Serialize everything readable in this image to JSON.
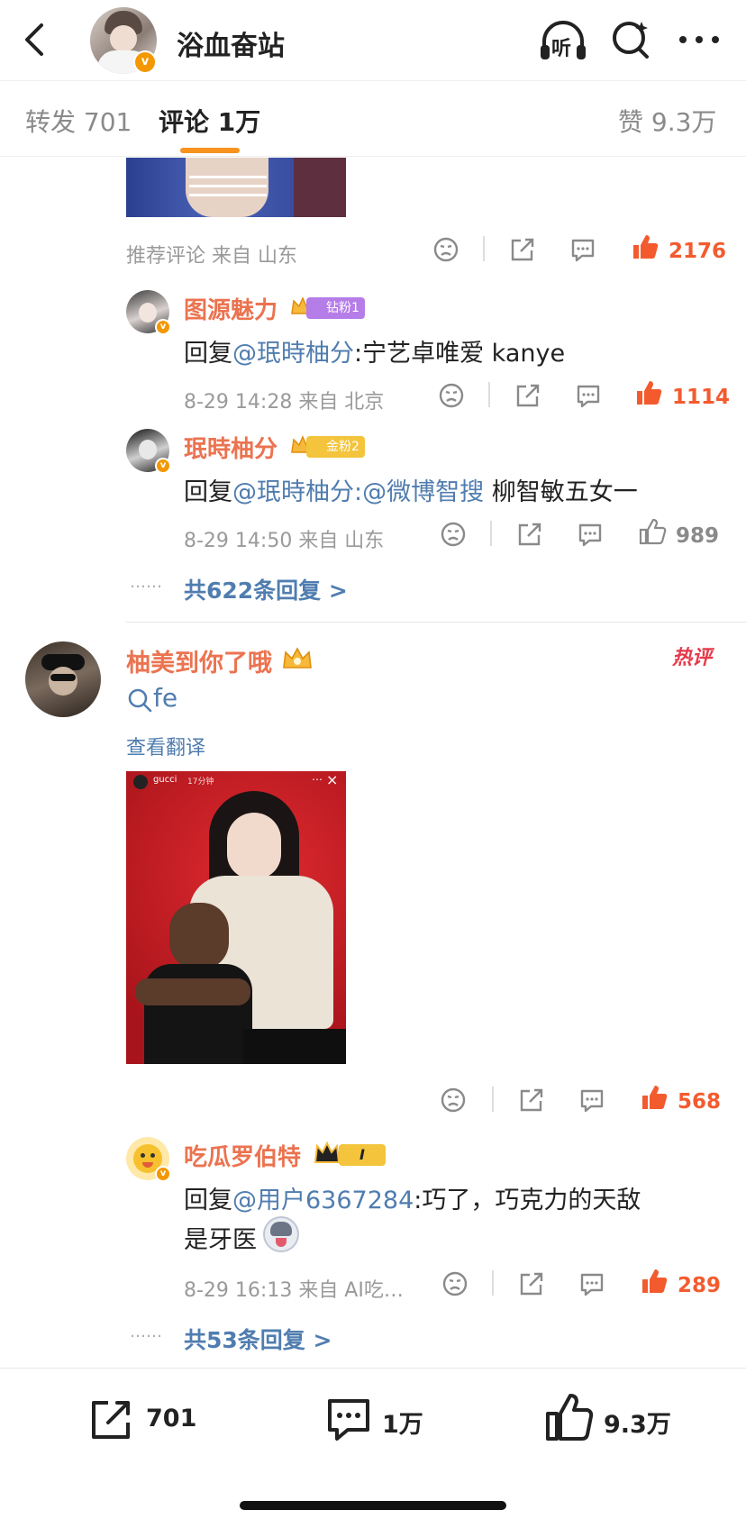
{
  "header": {
    "title": "浴血奋站",
    "verified_icon": "v-badge",
    "icons": [
      "back-chevron-icon",
      "listen-headphones-icon",
      "search-icon",
      "more-icon"
    ],
    "listen_label": "听"
  },
  "tabs": {
    "repost": "转发 701",
    "comments": "评论 1万",
    "likes": "赞 9.3万",
    "active": "comments",
    "accent": "#f7931e"
  },
  "comment1": {
    "meta": "推荐评论  来自 山东",
    "likes": "2176",
    "replies": [
      {
        "name": "图源魅力",
        "badge": "钻粉1",
        "reply_prefix": "回复",
        "mention": "@珉時柚分",
        "text": ":宁艺卓唯爱 kanye",
        "meta": "8-29 14:28  来自 北京",
        "likes": "1114"
      },
      {
        "name": "珉時柚分",
        "badge": "金粉2",
        "reply_prefix": "回复",
        "mention": "@珉時柚分",
        "mention2": ":@微博智搜",
        "text": " 柳智敏五女一",
        "meta": "8-29 14:50  来自 山东",
        "likes": "989"
      }
    ],
    "more": "共622条回复 >",
    "dots": "……"
  },
  "comment2": {
    "name": "柚美到你了哦",
    "hot_label": "热评",
    "search_text": "fe",
    "translate": "查看翻译",
    "image_header": "gucci",
    "image_time": "17分钟",
    "likes": "568",
    "replies": [
      {
        "name": "吃瓜罗伯特",
        "badge": "I",
        "reply_prefix": "回复",
        "mention": "@用户6367284",
        "text": ":巧了，巧克力的天敌",
        "text2": "是牙医",
        "meta": "8-29 16:13  来自 AI吃…",
        "likes": "289"
      }
    ],
    "more": "共53条回复 >",
    "dots": "……"
  },
  "bottom": {
    "repost": "701",
    "comments": "1万",
    "likes": "9.3万"
  },
  "colors": {
    "name_orange": "#eb7350",
    "mention_blue": "#507daf",
    "like_orange": "#f35b2e",
    "badge_purple": "#b57de8",
    "badge_gold": "#f3c43c",
    "hot_red": "#e6394a"
  }
}
